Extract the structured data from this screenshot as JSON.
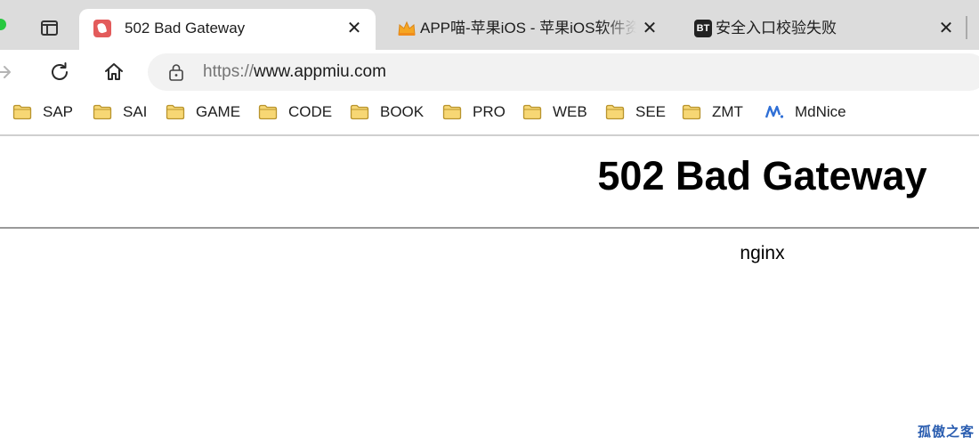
{
  "tabs": [
    {
      "title": "502 Bad Gateway",
      "favicon": "red-rabbit-icon",
      "active": true
    },
    {
      "title": "APP喵-苹果iOS - 苹果iOS软件资源",
      "favicon": "orange-crown-icon",
      "active": false
    },
    {
      "title": "安全入口校验失败",
      "favicon": "bt-icon",
      "favicon_text": "BT",
      "active": false
    }
  ],
  "toolbar": {
    "url_scheme": "https://",
    "url_host": "www.appmiu.com"
  },
  "bookmarks": [
    {
      "label": "SAP",
      "icon": "folder-icon"
    },
    {
      "label": "SAI",
      "icon": "folder-icon"
    },
    {
      "label": "GAME",
      "icon": "folder-icon"
    },
    {
      "label": "CODE",
      "icon": "folder-icon"
    },
    {
      "label": "BOOK",
      "icon": "folder-icon"
    },
    {
      "label": "PRO",
      "icon": "folder-icon"
    },
    {
      "label": "WEB",
      "icon": "folder-icon"
    },
    {
      "label": "SEE",
      "icon": "folder-icon"
    },
    {
      "label": "ZMT",
      "icon": "folder-icon"
    },
    {
      "label": "MdNice",
      "icon": "mdnice-icon"
    }
  ],
  "page": {
    "heading": "502 Bad Gateway",
    "server": "nginx"
  },
  "watermark": "孤傲之客",
  "colors": {
    "folder": "#f7d774",
    "folder_stroke": "#b8942e",
    "accent_blue": "#2a5db0",
    "tabbar": "#dcdcdc"
  }
}
